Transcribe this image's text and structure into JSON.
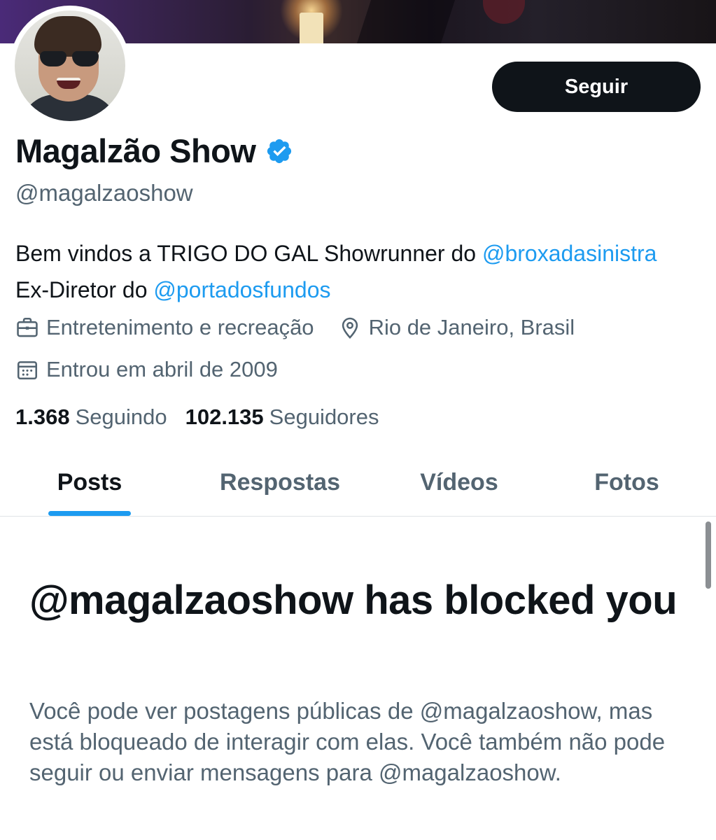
{
  "profile": {
    "display_name": "Magalzão Show",
    "handle": "@magalzaoshow",
    "follow_label": "Seguir",
    "bio": {
      "part1": "Bem vindos a TRIGO DO GAL Showrunner do ",
      "mention1": "@broxadasinistra",
      "part2": " Ex-Diretor do ",
      "mention2": "@portadosfundos"
    },
    "category": "Entretenimento e recreação",
    "location": "Rio de Janeiro, Brasil",
    "joined": "Entrou em abril de 2009",
    "following_count": "1.368",
    "following_label": "Seguindo",
    "followers_count": "102.135",
    "followers_label": "Seguidores"
  },
  "tabs": [
    {
      "label": "Posts",
      "active": true
    },
    {
      "label": "Respostas",
      "active": false
    },
    {
      "label": "Vídeos",
      "active": false
    },
    {
      "label": "Fotos",
      "active": false
    }
  ],
  "blocked": {
    "title": "@magalzaoshow has blocked you",
    "description": "Você pode ver postagens públicas de @magalzaoshow, mas está bloqueado de interagir com elas. Você também não pode seguir ou enviar mensagens para @magalzaoshow."
  },
  "colors": {
    "accent": "#1d9bf0",
    "text_primary": "#0f1419",
    "text_secondary": "#536471",
    "button_bg": "#0f1419"
  },
  "icons": {
    "verified": "verified-badge-icon",
    "category": "briefcase-icon",
    "location": "location-pin-icon",
    "joined": "calendar-icon"
  }
}
